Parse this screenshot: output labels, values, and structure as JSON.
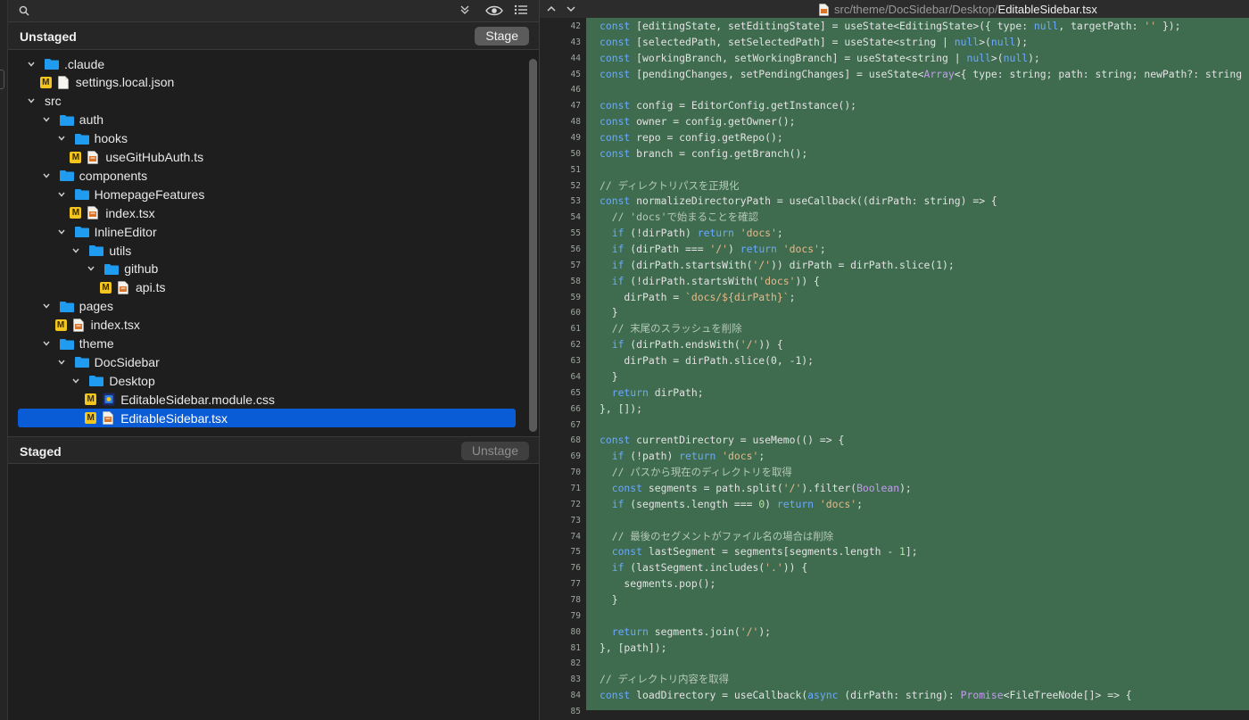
{
  "left_panel": {
    "unstaged_title": "Unstaged",
    "stage_label": "Stage",
    "staged_title": "Staged",
    "unstage_label": "Unstage",
    "tree": [
      {
        "label": ".claude",
        "kind": "folder",
        "depth": 0,
        "expanded": true
      },
      {
        "label": "settings.local.json",
        "kind": "file",
        "depth": 1,
        "badge": "M",
        "file_icon": "json-file-icon"
      },
      {
        "label": "src",
        "kind": "folder",
        "depth": 0,
        "expanded": true,
        "no_icon": true
      },
      {
        "label": "auth",
        "kind": "folder",
        "depth": 1,
        "expanded": true
      },
      {
        "label": "hooks",
        "kind": "folder",
        "depth": 2,
        "expanded": true
      },
      {
        "label": "useGitHubAuth.ts",
        "kind": "file",
        "depth": 3,
        "badge": "M",
        "file_icon": "ts-file-icon"
      },
      {
        "label": "components",
        "kind": "folder",
        "depth": 1,
        "expanded": true
      },
      {
        "label": "HomepageFeatures",
        "kind": "folder",
        "depth": 2,
        "expanded": true
      },
      {
        "label": "index.tsx",
        "kind": "file",
        "depth": 3,
        "badge": "M",
        "file_icon": "tsx-file-icon"
      },
      {
        "label": "InlineEditor",
        "kind": "folder",
        "depth": 2,
        "expanded": true
      },
      {
        "label": "utils",
        "kind": "folder",
        "depth": 3,
        "expanded": true
      },
      {
        "label": "github",
        "kind": "folder",
        "depth": 4,
        "expanded": true
      },
      {
        "label": "api.ts",
        "kind": "file",
        "depth": 5,
        "badge": "M",
        "file_icon": "ts-file-icon"
      },
      {
        "label": "pages",
        "kind": "folder",
        "depth": 1,
        "expanded": true
      },
      {
        "label": "index.tsx",
        "kind": "file",
        "depth": 2,
        "badge": "M",
        "file_icon": "tsx-file-icon"
      },
      {
        "label": "theme",
        "kind": "folder",
        "depth": 1,
        "expanded": true
      },
      {
        "label": "DocSidebar",
        "kind": "folder",
        "depth": 2,
        "expanded": true
      },
      {
        "label": "Desktop",
        "kind": "folder",
        "depth": 3,
        "expanded": true
      },
      {
        "label": "EditableSidebar.module.css",
        "kind": "file",
        "depth": 4,
        "badge": "M",
        "file_icon": "css-file-icon"
      },
      {
        "label": "EditableSidebar.tsx",
        "kind": "file",
        "depth": 4,
        "badge": "M",
        "file_icon": "tsx-file-icon",
        "selected": true
      }
    ]
  },
  "right_panel": {
    "path_prefix": "src/theme/DocSidebar/Desktop/",
    "path_file": "EditableSidebar.tsx",
    "code_lines": [
      {
        "n": "42",
        "html": "<span class=\"k\">const</span> [editingState, setEditingState] = useState&lt;EditingState&gt;({ type: <span class=\"k\">null</span>, targetPath: <span class=\"s\">''</span> });"
      },
      {
        "n": "43",
        "html": "<span class=\"k\">const</span> [selectedPath, setSelectedPath] = useState&lt;string | <span class=\"k\">null</span>&gt;(<span class=\"k\">null</span>);"
      },
      {
        "n": "44",
        "html": "<span class=\"k\">const</span> [workingBranch, setWorkingBranch] = useState&lt;string | <span class=\"k\">null</span>&gt;(<span class=\"k\">null</span>);"
      },
      {
        "n": "45",
        "html": "<span class=\"k\">const</span> [pendingChanges, setPendingChanges] = useState&lt;<span class=\"t\">Array</span>&lt;{ type: string; path: string; newPath?: string"
      },
      {
        "n": "46",
        "html": ""
      },
      {
        "n": "47",
        "html": "<span class=\"k\">const</span> config = EditorConfig.getInstance();"
      },
      {
        "n": "48",
        "html": "<span class=\"k\">const</span> owner = config.getOwner();"
      },
      {
        "n": "49",
        "html": "<span class=\"k\">const</span> repo = config.getRepo();"
      },
      {
        "n": "50",
        "html": "<span class=\"k\">const</span> branch = config.getBranch();"
      },
      {
        "n": "51",
        "html": ""
      },
      {
        "n": "52",
        "html": "<span class=\"c\">// ディレクトリパスを正規化</span>"
      },
      {
        "n": "53",
        "html": "<span class=\"k\">const</span> normalizeDirectoryPath = useCallback((dirPath: string) =&gt; {"
      },
      {
        "n": "54",
        "html": "  <span class=\"c\">// 'docs'で始まることを確認</span>"
      },
      {
        "n": "55",
        "html": "  <span class=\"k\">if</span> (!dirPath) <span class=\"k\">return</span> <span class=\"s\">'docs'</span>;"
      },
      {
        "n": "56",
        "html": "  <span class=\"k\">if</span> (dirPath === <span class=\"s\">'/'</span>) <span class=\"k\">return</span> <span class=\"s\">'docs'</span>;"
      },
      {
        "n": "57",
        "html": "  <span class=\"k\">if</span> (dirPath.startsWith(<span class=\"s\">'/'</span>)) dirPath = dirPath.slice(1);"
      },
      {
        "n": "58",
        "html": "  <span class=\"k\">if</span> (!dirPath.startsWith(<span class=\"s\">'docs'</span>)) {"
      },
      {
        "n": "59",
        "html": "    dirPath = <span class=\"s\">`docs/${dirPath}`</span>;"
      },
      {
        "n": "60",
        "html": "  }"
      },
      {
        "n": "61",
        "html": "  <span class=\"c\">// 末尾のスラッシュを削除</span>"
      },
      {
        "n": "62",
        "html": "  <span class=\"k\">if</span> (dirPath.endsWith(<span class=\"s\">'/'</span>)) {"
      },
      {
        "n": "63",
        "html": "    dirPath = dirPath.slice(0, -1);"
      },
      {
        "n": "64",
        "html": "  }"
      },
      {
        "n": "65",
        "html": "  <span class=\"k\">return</span> dirPath;"
      },
      {
        "n": "66",
        "html": "}, []);"
      },
      {
        "n": "67",
        "html": ""
      },
      {
        "n": "68",
        "html": "<span class=\"k\">const</span> currentDirectory = useMemo(() =&gt; {"
      },
      {
        "n": "69",
        "html": "  <span class=\"k\">if</span> (!path) <span class=\"k\">return</span> <span class=\"s\">'docs'</span>;"
      },
      {
        "n": "70",
        "html": "  <span class=\"c\">// パスから現在のディレクトリを取得</span>"
      },
      {
        "n": "71",
        "html": "  <span class=\"k\">const</span> segments = path.split(<span class=\"s\">'/'</span>).filter(<span class=\"t\">Boolean</span>);"
      },
      {
        "n": "72",
        "html": "  <span class=\"k\">if</span> (segments.length === <span class=\"n\">0</span>) <span class=\"k\">return</span> <span class=\"s\">'docs'</span>;"
      },
      {
        "n": "73",
        "html": ""
      },
      {
        "n": "74",
        "html": "  <span class=\"c\">// 最後のセグメントがファイル名の場合は削除</span>"
      },
      {
        "n": "75",
        "html": "  <span class=\"k\">const</span> lastSegment = segments[segments.length - <span class=\"n\">1</span>];"
      },
      {
        "n": "76",
        "html": "  <span class=\"k\">if</span> (lastSegment.includes(<span class=\"s\">'.'</span>)) {"
      },
      {
        "n": "77",
        "html": "    segments.pop();"
      },
      {
        "n": "78",
        "html": "  }"
      },
      {
        "n": "79",
        "html": ""
      },
      {
        "n": "80",
        "html": "  <span class=\"k\">return</span> segments.join(<span class=\"s\">'/'</span>);"
      },
      {
        "n": "81",
        "html": "}, [path]);"
      },
      {
        "n": "82",
        "html": ""
      },
      {
        "n": "83",
        "html": "<span class=\"c\">// ディレクトリ内容を取得</span>"
      },
      {
        "n": "84",
        "html": "<span class=\"k\">const</span> loadDirectory = useCallback(<span class=\"k\">async</span> (dirPath: string): <span class=\"t\">Promise</span>&lt;FileTreeNode[]&gt; =&gt; {"
      },
      {
        "n": "85",
        "html": ""
      }
    ]
  },
  "colors": {
    "selection": "#0a5bd6",
    "badge_modified": "#f2c61f",
    "folder": "#1f9bf0",
    "added_line_bg": "#3f6b4f",
    "keyword": "#6aa9ff",
    "string": "#e8b98a"
  },
  "icons": {
    "search": "search-icon",
    "collapse": "double-chevron-down-icon",
    "eye": "eye-icon",
    "list": "list-icon",
    "nav_up": "chevron-up-icon",
    "nav_down": "chevron-down-icon"
  }
}
